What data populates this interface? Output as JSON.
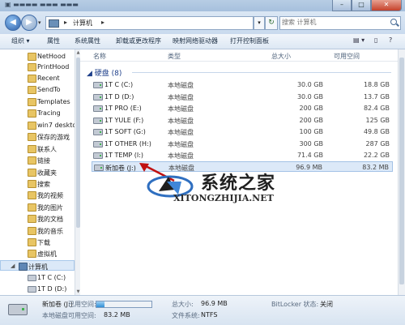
{
  "window": {
    "title": "计算机",
    "controls": [
      "–",
      "□",
      "✕"
    ]
  },
  "address": {
    "crumb": "计算机",
    "search_placeholder": "搜索 计算机"
  },
  "toolbar": {
    "organize": "组织 ▾",
    "properties": "属性",
    "system_properties": "系统属性",
    "uninstall": "卸载或更改程序",
    "map_drive": "映射网络驱动器",
    "control_panel": "打开控制面板",
    "view_icon": "▤ ▾",
    "pane_icon": "▯",
    "help_icon": "?"
  },
  "sidebar": {
    "items": [
      {
        "label": "NetHood",
        "icon": "folder-icon"
      },
      {
        "label": "PrintHood",
        "icon": "folder-icon"
      },
      {
        "label": "Recent",
        "icon": "folder-icon"
      },
      {
        "label": "SendTo",
        "icon": "folder-icon"
      },
      {
        "label": "Templates",
        "icon": "folder-icon"
      },
      {
        "label": "Tracing",
        "icon": "folder-icon"
      },
      {
        "label": "win7 desktop",
        "icon": "folder-icon"
      },
      {
        "label": "保存的游戏",
        "icon": "folder-icon"
      },
      {
        "label": "联系人",
        "icon": "folder-icon"
      },
      {
        "label": "链接",
        "icon": "folder-icon"
      },
      {
        "label": "收藏夹",
        "icon": "folder-icon"
      },
      {
        "label": "搜索",
        "icon": "folder-icon"
      },
      {
        "label": "我的视频",
        "icon": "folder-icon"
      },
      {
        "label": "我的图片",
        "icon": "folder-icon"
      },
      {
        "label": "我的文档",
        "icon": "folder-icon"
      },
      {
        "label": "我的音乐",
        "icon": "folder-icon"
      },
      {
        "label": "下载",
        "icon": "folder-icon"
      },
      {
        "label": "虚拟机",
        "icon": "folder-icon"
      }
    ],
    "computer": "计算机",
    "drives": [
      "1T C (C:)",
      "1T D (D:)"
    ]
  },
  "columns": {
    "name": "名称",
    "type": "类型",
    "total": "总大小",
    "free": "可用空间"
  },
  "group": {
    "label": "硬盘 (8)"
  },
  "drives": [
    {
      "name": "1T C (C:)",
      "type": "本地磁盘",
      "total": "30.0 GB",
      "free": "18.8 GB"
    },
    {
      "name": "1T D (D:)",
      "type": "本地磁盘",
      "total": "30.0 GB",
      "free": "13.7 GB"
    },
    {
      "name": "1T PRO (E:)",
      "type": "本地磁盘",
      "total": "200 GB",
      "free": "82.4 GB"
    },
    {
      "name": "1T YULE (F:)",
      "type": "本地磁盘",
      "total": "200 GB",
      "free": "125 GB"
    },
    {
      "name": "1T SOFT (G:)",
      "type": "本地磁盘",
      "total": "100 GB",
      "free": "49.8 GB"
    },
    {
      "name": "1T OTHER (H:)",
      "type": "本地磁盘",
      "total": "300 GB",
      "free": "287 GB"
    },
    {
      "name": "1T TEMP (I:)",
      "type": "本地磁盘",
      "total": "71.4 GB",
      "free": "22.2 GB"
    },
    {
      "name": "新加卷 (J:)",
      "type": "本地磁盘",
      "total": "96.9 MB",
      "free": "83.2 MB"
    }
  ],
  "watermark": {
    "text": "系统之家",
    "url": "XITONGZHIJIA.NET"
  },
  "details": {
    "name": "新加卷 (J:)",
    "type": "本地磁盘",
    "used_label": "已用空间:",
    "used_fraction": 0.14,
    "free_label": "可用空间:",
    "free_value": "83.2 MB",
    "total_label": "总大小:",
    "total_value": "96.9 MB",
    "fs_label": "文件系统:",
    "fs_value": "NTFS",
    "bitlocker_label": "BitLocker 状态:",
    "bitlocker_value": "关闭"
  }
}
